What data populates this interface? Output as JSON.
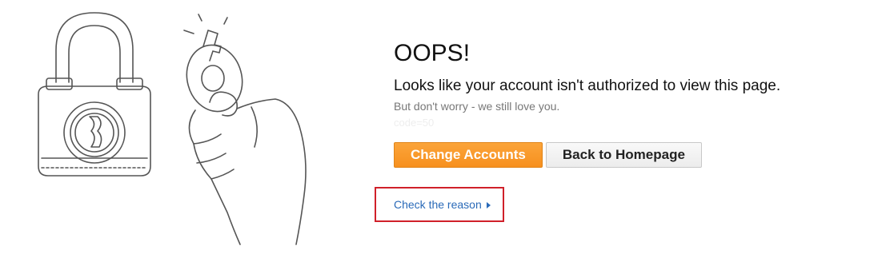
{
  "error": {
    "title": "OOPS!",
    "headline": "Looks like your account isn't authorized to view this page.",
    "subtext": "But don't worry - we still love you.",
    "code": "code=50"
  },
  "actions": {
    "change_accounts_label": "Change Accounts",
    "back_home_label": "Back to Homepage",
    "check_reason_label": "Check the reason"
  },
  "icons": {
    "illustration": "padlock-and-key-illustration",
    "link_arrow": "caret-right-icon"
  },
  "colors": {
    "primary_button": "#f7901e",
    "link": "#2a6ab8",
    "highlight_border": "#d0202a"
  }
}
